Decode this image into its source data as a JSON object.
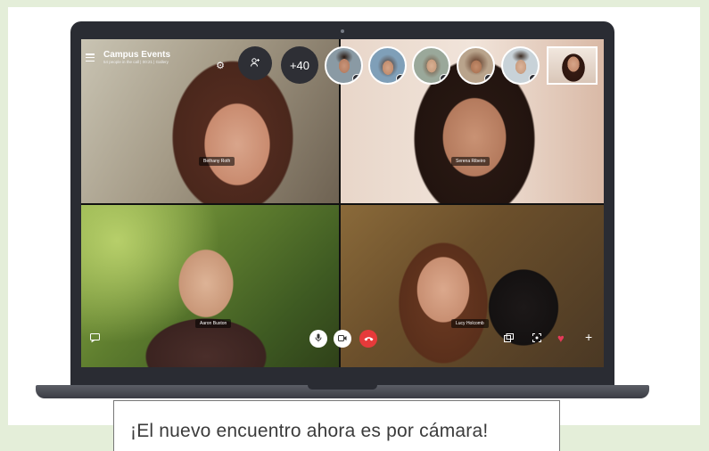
{
  "call": {
    "title": "Campus Events",
    "subtitle": "54 people in the call | 00:21 | Gallery",
    "overflow_count": "+40"
  },
  "participants": [
    {
      "name": "Bethany Roth"
    },
    {
      "name": "Serena Ribeiro"
    },
    {
      "name": "Aaron Buxton"
    },
    {
      "name": "Lucy Holcomb"
    }
  ],
  "icons": {
    "menu": "hamburger-icon",
    "settings": "gear-icon",
    "add_people": "add-person-icon",
    "mic": "microphone-icon",
    "video": "video-camera-icon",
    "hangup": "phone-hangup-icon",
    "chat": "chat-icon",
    "share": "screen-share-icon",
    "focus": "focus-icon",
    "react": "heart-icon",
    "more": "plus-icon"
  },
  "colors": {
    "background": "#e4eed9",
    "hangup": "#e63a3a",
    "heart": "#e63a5a",
    "laptop": "#2a2c33"
  },
  "caption": "¡El nuevo encuentro ahora es por cámara!"
}
